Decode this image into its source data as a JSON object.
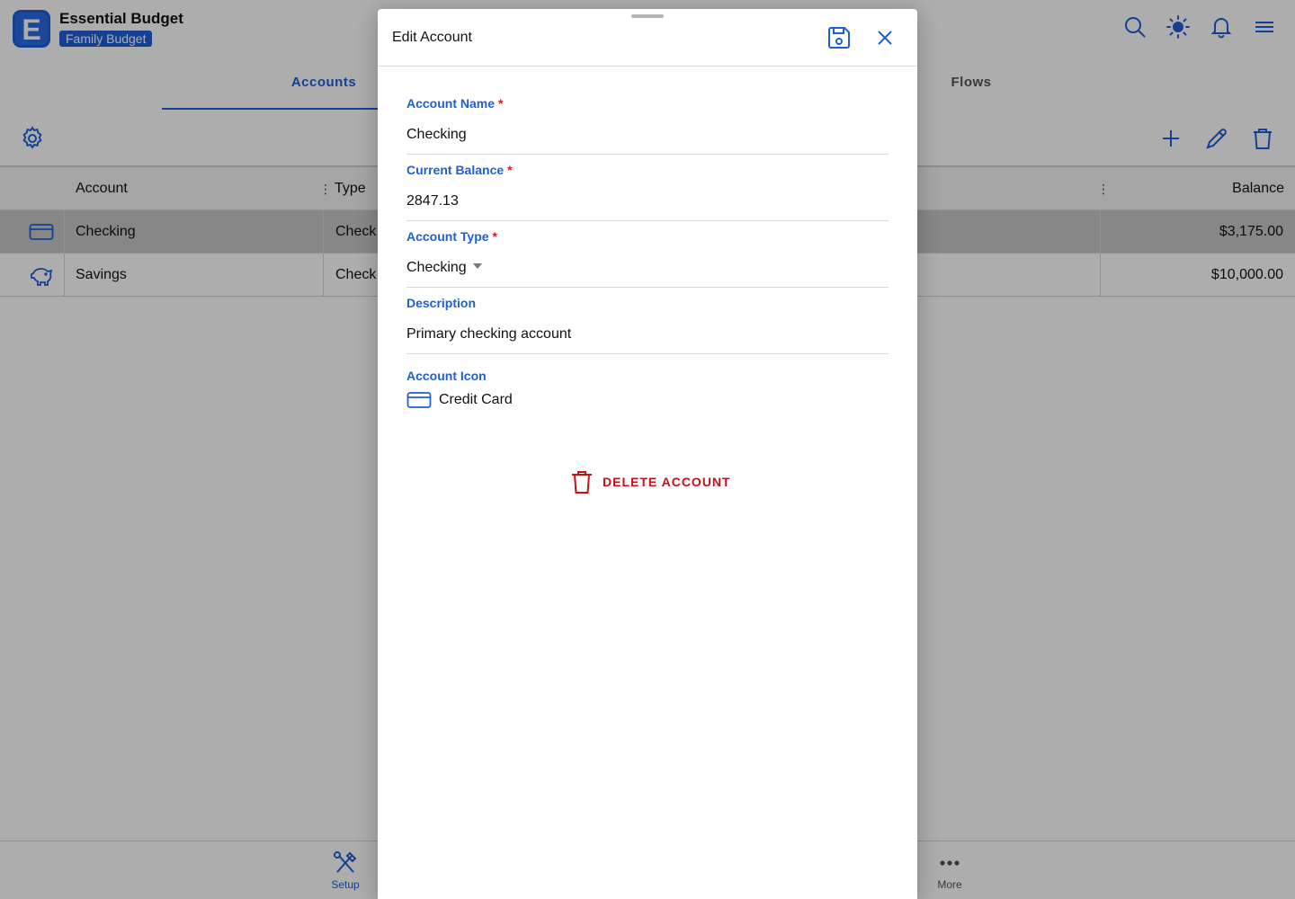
{
  "app": {
    "title": "Essential Budget",
    "badge": "Family Budget"
  },
  "tabs": [
    {
      "label": "Accounts",
      "active": true
    },
    {
      "label": "Flows",
      "active": false
    }
  ],
  "table": {
    "headers": {
      "account": "Account",
      "type": "Type",
      "balance": "Balance"
    },
    "rows": [
      {
        "icon": "credit-card-icon",
        "account": "Checking",
        "type": "Check",
        "balance": "$3,175.00",
        "selected": true
      },
      {
        "icon": "piggy-bank-icon",
        "account": "Savings",
        "type": "Check",
        "balance": "$10,000.00",
        "selected": false
      }
    ]
  },
  "bottom_nav": [
    {
      "label": "Setup",
      "icon": "tools-icon",
      "active": true
    },
    {
      "label": "More",
      "icon": "more-dots-icon",
      "active": false
    }
  ],
  "modal": {
    "title": "Edit Account",
    "fields": {
      "name": {
        "label": "Account Name",
        "required_mark": "*",
        "value": "Checking"
      },
      "balance": {
        "label": "Current Balance",
        "required_mark": "*",
        "value": "2847.13"
      },
      "type": {
        "label": "Account Type",
        "required_mark": "*",
        "value": "Checking"
      },
      "description": {
        "label": "Description",
        "value": "Primary checking account"
      },
      "icon": {
        "label": "Account Icon",
        "value": "Credit Card",
        "icon": "credit-card-icon"
      }
    },
    "delete_label": "DELETE ACCOUNT"
  },
  "colors": {
    "accent": "#1f5fd6",
    "danger": "#c8101a",
    "required": "#d0202a"
  }
}
